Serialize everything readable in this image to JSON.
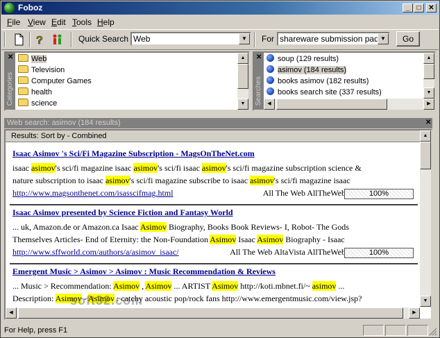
{
  "window": {
    "title": "Foboz"
  },
  "menu": [
    {
      "key": "F",
      "rest": "ile"
    },
    {
      "key": "V",
      "rest": "iew"
    },
    {
      "key": "E",
      "rest": "dit"
    },
    {
      "key": "T",
      "rest": "ools"
    },
    {
      "key": "H",
      "rest": "elp"
    }
  ],
  "toolbar": {
    "quick_search_label": "Quick Search",
    "quick_search_value": "Web",
    "for_label": "For",
    "for_value": "shareware submission pad",
    "go_label": "Go"
  },
  "categories": {
    "tab_label": "Categories",
    "items": [
      "Web",
      "Television",
      "Computer Games",
      "health",
      "science"
    ],
    "selected_index": 0
  },
  "searches": {
    "tab_label": "Searches",
    "items": [
      "soup (129 results)",
      "asimov (184 results)",
      "books asimov (182 results)",
      "books search site (337 results)"
    ],
    "selected_index": 1
  },
  "web_search": {
    "header": "Web search: asimov (184 results)",
    "results_header": "Results: Sort by - Combined"
  },
  "results": [
    {
      "title": "Isaac Asimov 's Sci/Fi Magazine Subscription - MagsOnTheNet.com ",
      "line1": [
        [
          "isaac ",
          0
        ],
        [
          "asimov",
          1
        ],
        [
          "'s sci/fi magazine isaac ",
          0
        ],
        [
          "asimov",
          1
        ],
        [
          "'s sci/fi isaac ",
          0
        ],
        [
          "asimov",
          1
        ],
        [
          "'s sci/fi magazine subscription science &",
          0
        ]
      ],
      "line2": [
        [
          "nature subscription to isaac ",
          0
        ],
        [
          "asimov",
          1
        ],
        [
          "'s sci/fi magazine subscribe to isaac ",
          0
        ],
        [
          "asimov",
          1
        ],
        [
          "'s sci/fi magazine isaac",
          0
        ]
      ],
      "url": "http://www.magsonthenet.com/isasscifmag.html",
      "engines": "All The Web AllTheWeb",
      "score": "100%"
    },
    {
      "title": "Isaac Asimov presented by Science Fiction and Fantasy World ",
      "line1": [
        [
          "... uk, Amazon.de or Amazon.ca Isaac ",
          0
        ],
        [
          "Asimov",
          1
        ],
        [
          " Biography, Books Book Reviews- I, Robot- The Gods",
          0
        ]
      ],
      "line2": [
        [
          "Themselves Articles- End of Eternity: the Non-Foundation ",
          0
        ],
        [
          "Asimov",
          1
        ],
        [
          " Isaac ",
          0
        ],
        [
          "Asimov",
          1
        ],
        [
          " Biography - Isaac",
          0
        ]
      ],
      "url": "http://www.sffworld.com/authors/a/asimov_isaac/",
      "engines": "All The Web AltaVista AllTheWeb",
      "score": "100%"
    },
    {
      "title": "Emergent Music > Asimov > Asimov : Music Recommendation & Reviews ",
      "line1": [
        [
          "... Music > Recommendation: ",
          0
        ],
        [
          "Asimov",
          1
        ],
        [
          " , ",
          0
        ],
        [
          "Asimov",
          1
        ],
        [
          " ... ARTIST ",
          0
        ],
        [
          "Asimov",
          1
        ],
        [
          " http://koti.mbnet.fi/~ ",
          0
        ],
        [
          "asimov",
          1
        ],
        [
          " ...",
          0
        ]
      ],
      "line2": [
        [
          "Description: ",
          0
        ],
        [
          "Asimov",
          1
        ],
        [
          " - ",
          0
        ],
        [
          "Asimov",
          1
        ],
        [
          " : catchy acoustic pop/rock fans http://www.emergentmusic.com/view.jsp?",
          0
        ]
      ],
      "url": "",
      "engines": "",
      "score": ""
    }
  ],
  "statusbar": {
    "text": "For Help, press F1"
  },
  "watermark": "soft32.com",
  "colors": {
    "title_start": "#0a246a",
    "title_end": "#a6caf0",
    "highlight": "#ffff00",
    "link": "#00008b"
  }
}
